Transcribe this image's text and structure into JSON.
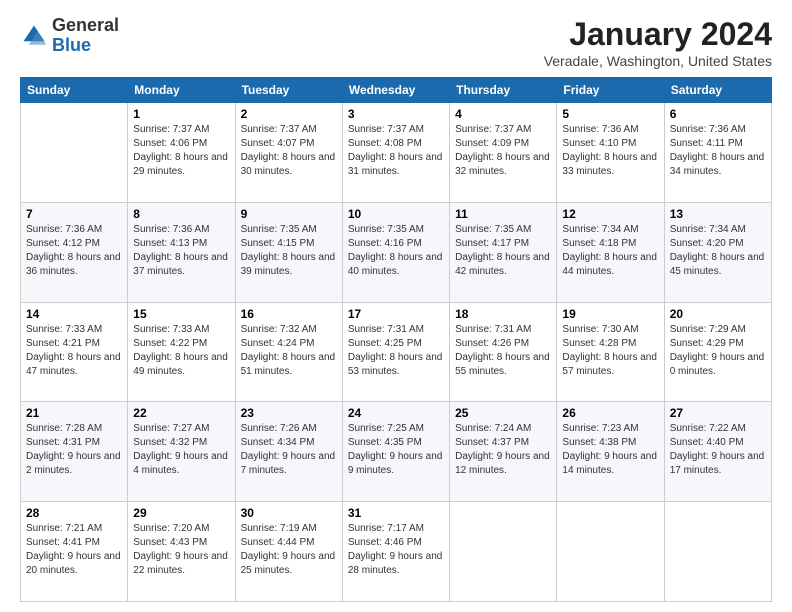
{
  "logo": {
    "general": "General",
    "blue": "Blue"
  },
  "header": {
    "month": "January 2024",
    "location": "Veradale, Washington, United States"
  },
  "weekdays": [
    "Sunday",
    "Monday",
    "Tuesday",
    "Wednesday",
    "Thursday",
    "Friday",
    "Saturday"
  ],
  "weeks": [
    [
      {
        "day": "",
        "sunrise": "",
        "sunset": "",
        "daylight": ""
      },
      {
        "day": "1",
        "sunrise": "Sunrise: 7:37 AM",
        "sunset": "Sunset: 4:06 PM",
        "daylight": "Daylight: 8 hours and 29 minutes."
      },
      {
        "day": "2",
        "sunrise": "Sunrise: 7:37 AM",
        "sunset": "Sunset: 4:07 PM",
        "daylight": "Daylight: 8 hours and 30 minutes."
      },
      {
        "day": "3",
        "sunrise": "Sunrise: 7:37 AM",
        "sunset": "Sunset: 4:08 PM",
        "daylight": "Daylight: 8 hours and 31 minutes."
      },
      {
        "day": "4",
        "sunrise": "Sunrise: 7:37 AM",
        "sunset": "Sunset: 4:09 PM",
        "daylight": "Daylight: 8 hours and 32 minutes."
      },
      {
        "day": "5",
        "sunrise": "Sunrise: 7:36 AM",
        "sunset": "Sunset: 4:10 PM",
        "daylight": "Daylight: 8 hours and 33 minutes."
      },
      {
        "day": "6",
        "sunrise": "Sunrise: 7:36 AM",
        "sunset": "Sunset: 4:11 PM",
        "daylight": "Daylight: 8 hours and 34 minutes."
      }
    ],
    [
      {
        "day": "7",
        "sunrise": "Sunrise: 7:36 AM",
        "sunset": "Sunset: 4:12 PM",
        "daylight": "Daylight: 8 hours and 36 minutes."
      },
      {
        "day": "8",
        "sunrise": "Sunrise: 7:36 AM",
        "sunset": "Sunset: 4:13 PM",
        "daylight": "Daylight: 8 hours and 37 minutes."
      },
      {
        "day": "9",
        "sunrise": "Sunrise: 7:35 AM",
        "sunset": "Sunset: 4:15 PM",
        "daylight": "Daylight: 8 hours and 39 minutes."
      },
      {
        "day": "10",
        "sunrise": "Sunrise: 7:35 AM",
        "sunset": "Sunset: 4:16 PM",
        "daylight": "Daylight: 8 hours and 40 minutes."
      },
      {
        "day": "11",
        "sunrise": "Sunrise: 7:35 AM",
        "sunset": "Sunset: 4:17 PM",
        "daylight": "Daylight: 8 hours and 42 minutes."
      },
      {
        "day": "12",
        "sunrise": "Sunrise: 7:34 AM",
        "sunset": "Sunset: 4:18 PM",
        "daylight": "Daylight: 8 hours and 44 minutes."
      },
      {
        "day": "13",
        "sunrise": "Sunrise: 7:34 AM",
        "sunset": "Sunset: 4:20 PM",
        "daylight": "Daylight: 8 hours and 45 minutes."
      }
    ],
    [
      {
        "day": "14",
        "sunrise": "Sunrise: 7:33 AM",
        "sunset": "Sunset: 4:21 PM",
        "daylight": "Daylight: 8 hours and 47 minutes."
      },
      {
        "day": "15",
        "sunrise": "Sunrise: 7:33 AM",
        "sunset": "Sunset: 4:22 PM",
        "daylight": "Daylight: 8 hours and 49 minutes."
      },
      {
        "day": "16",
        "sunrise": "Sunrise: 7:32 AM",
        "sunset": "Sunset: 4:24 PM",
        "daylight": "Daylight: 8 hours and 51 minutes."
      },
      {
        "day": "17",
        "sunrise": "Sunrise: 7:31 AM",
        "sunset": "Sunset: 4:25 PM",
        "daylight": "Daylight: 8 hours and 53 minutes."
      },
      {
        "day": "18",
        "sunrise": "Sunrise: 7:31 AM",
        "sunset": "Sunset: 4:26 PM",
        "daylight": "Daylight: 8 hours and 55 minutes."
      },
      {
        "day": "19",
        "sunrise": "Sunrise: 7:30 AM",
        "sunset": "Sunset: 4:28 PM",
        "daylight": "Daylight: 8 hours and 57 minutes."
      },
      {
        "day": "20",
        "sunrise": "Sunrise: 7:29 AM",
        "sunset": "Sunset: 4:29 PM",
        "daylight": "Daylight: 9 hours and 0 minutes."
      }
    ],
    [
      {
        "day": "21",
        "sunrise": "Sunrise: 7:28 AM",
        "sunset": "Sunset: 4:31 PM",
        "daylight": "Daylight: 9 hours and 2 minutes."
      },
      {
        "day": "22",
        "sunrise": "Sunrise: 7:27 AM",
        "sunset": "Sunset: 4:32 PM",
        "daylight": "Daylight: 9 hours and 4 minutes."
      },
      {
        "day": "23",
        "sunrise": "Sunrise: 7:26 AM",
        "sunset": "Sunset: 4:34 PM",
        "daylight": "Daylight: 9 hours and 7 minutes."
      },
      {
        "day": "24",
        "sunrise": "Sunrise: 7:25 AM",
        "sunset": "Sunset: 4:35 PM",
        "daylight": "Daylight: 9 hours and 9 minutes."
      },
      {
        "day": "25",
        "sunrise": "Sunrise: 7:24 AM",
        "sunset": "Sunset: 4:37 PM",
        "daylight": "Daylight: 9 hours and 12 minutes."
      },
      {
        "day": "26",
        "sunrise": "Sunrise: 7:23 AM",
        "sunset": "Sunset: 4:38 PM",
        "daylight": "Daylight: 9 hours and 14 minutes."
      },
      {
        "day": "27",
        "sunrise": "Sunrise: 7:22 AM",
        "sunset": "Sunset: 4:40 PM",
        "daylight": "Daylight: 9 hours and 17 minutes."
      }
    ],
    [
      {
        "day": "28",
        "sunrise": "Sunrise: 7:21 AM",
        "sunset": "Sunset: 4:41 PM",
        "daylight": "Daylight: 9 hours and 20 minutes."
      },
      {
        "day": "29",
        "sunrise": "Sunrise: 7:20 AM",
        "sunset": "Sunset: 4:43 PM",
        "daylight": "Daylight: 9 hours and 22 minutes."
      },
      {
        "day": "30",
        "sunrise": "Sunrise: 7:19 AM",
        "sunset": "Sunset: 4:44 PM",
        "daylight": "Daylight: 9 hours and 25 minutes."
      },
      {
        "day": "31",
        "sunrise": "Sunrise: 7:17 AM",
        "sunset": "Sunset: 4:46 PM",
        "daylight": "Daylight: 9 hours and 28 minutes."
      },
      {
        "day": "",
        "sunrise": "",
        "sunset": "",
        "daylight": ""
      },
      {
        "day": "",
        "sunrise": "",
        "sunset": "",
        "daylight": ""
      },
      {
        "day": "",
        "sunrise": "",
        "sunset": "",
        "daylight": ""
      }
    ]
  ]
}
